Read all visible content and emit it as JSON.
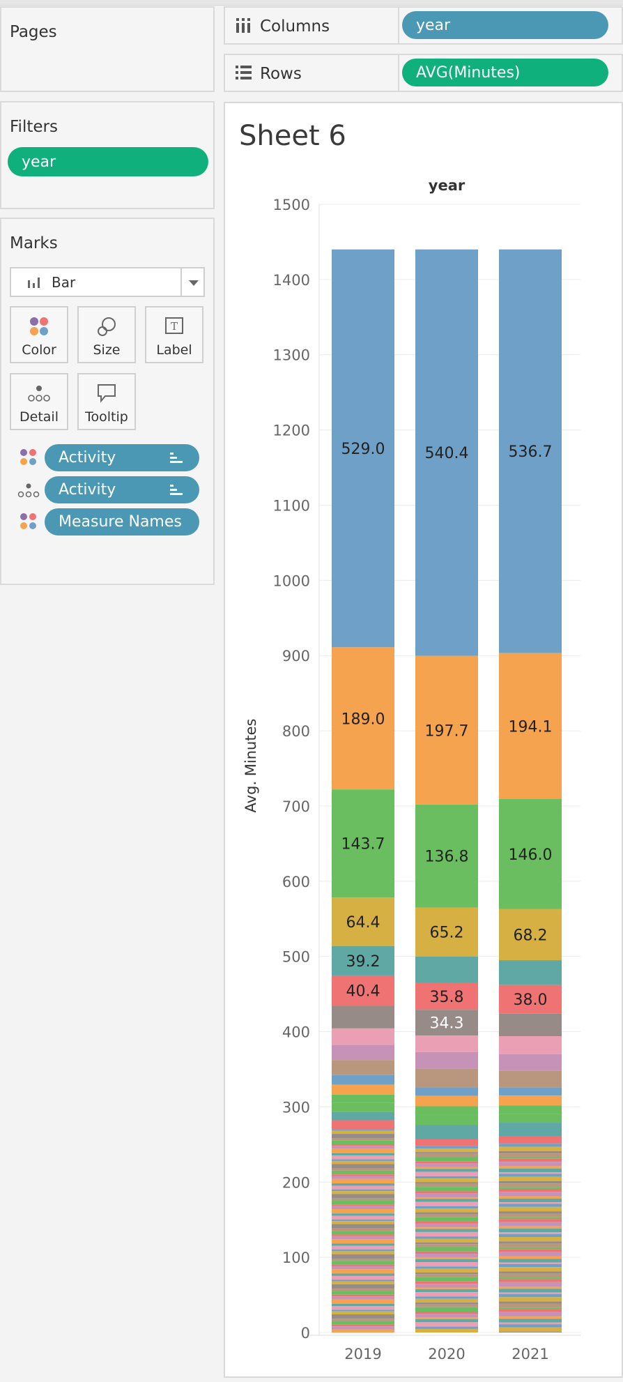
{
  "pages": {
    "title": "Pages"
  },
  "filters": {
    "title": "Filters",
    "pills": [
      "year"
    ]
  },
  "marks": {
    "title": "Marks",
    "mark_type": "Bar",
    "buttons": {
      "color": "Color",
      "size": "Size",
      "label": "Label",
      "detail": "Detail",
      "tooltip": "Tooltip"
    },
    "pills": [
      "Activity",
      "Activity",
      "Measure Names"
    ]
  },
  "shelves": {
    "columns_label": "Columns",
    "columns_pill": "year",
    "rows_label": "Rows",
    "rows_pill": "AVG(Minutes)"
  },
  "colors": {
    "accent_green": "#0fb07c",
    "accent_teal": "#4a98b3",
    "palette": [
      "#6fa1c8",
      "#f5a34f",
      "#6abe5f",
      "#d6b042",
      "#5fa8a4",
      "#ef7373",
      "#968b87",
      "#ea9fb4",
      "#c792b7",
      "#b9977e"
    ]
  },
  "sheet": {
    "title": "Sheet 6"
  },
  "chart_data": {
    "type": "bar",
    "stacked": true,
    "title": "year",
    "ylabel": "Avg. Minutes",
    "ylim": [
      0,
      1500
    ],
    "yticks": [
      0,
      100,
      200,
      300,
      400,
      500,
      600,
      700,
      800,
      900,
      1000,
      1100,
      1200,
      1300,
      1400,
      1500
    ],
    "categories": [
      "2019",
      "2020",
      "2021"
    ],
    "grid": true,
    "total": [
      1440,
      1440,
      1440
    ],
    "labeled_segments": [
      {
        "values": [
          529.0,
          540.4,
          536.7
        ],
        "labels": [
          "529.0",
          "540.4",
          "536.7"
        ],
        "color": "#6fa1c8",
        "label_color": "#222222"
      },
      {
        "values": [
          189.0,
          197.7,
          194.1
        ],
        "labels": [
          "189.0",
          "197.7",
          "194.1"
        ],
        "color": "#f5a34f",
        "label_color": "#222222"
      },
      {
        "values": [
          143.7,
          136.8,
          146.0
        ],
        "labels": [
          "143.7",
          "136.8",
          "146.0"
        ],
        "color": "#6abe5f",
        "label_color": "#222222"
      },
      {
        "values": [
          64.4,
          65.2,
          68.2
        ],
        "labels": [
          "64.4",
          "65.2",
          "68.2"
        ],
        "color": "#d6b042",
        "label_color": "#222222"
      },
      {
        "values": [
          39.2,
          35.0,
          33.0
        ],
        "labels": [
          "39.2",
          "",
          ""
        ],
        "color": "#5fa8a4",
        "label_color": "#222222"
      },
      {
        "values": [
          40.4,
          35.8,
          38.0
        ],
        "labels": [
          "40.4",
          "35.8",
          "38.0"
        ],
        "color": "#ef7373",
        "label_color": "#222222"
      },
      {
        "values": [
          30.0,
          34.3,
          30.0
        ],
        "labels": [
          "",
          "34.3",
          ""
        ],
        "color": "#968b87",
        "label_color": "#ffffff"
      }
    ],
    "unlabeled_segments": [
      {
        "values": [
          22,
          22,
          24
        ],
        "color": "#ea9fb4"
      },
      {
        "values": [
          20,
          22,
          22
        ],
        "color": "#c792b7"
      },
      {
        "values": [
          20,
          25,
          22
        ],
        "color": "#b9977e"
      },
      {
        "values": [
          13,
          11,
          11
        ],
        "color": "#6fa1c8"
      },
      {
        "values": [
          13,
          14,
          13
        ],
        "color": "#f5a34f"
      },
      {
        "values": [
          11,
          12,
          11
        ],
        "color": "#6abe5f"
      },
      {
        "values": [
          12,
          13,
          12
        ],
        "color": "#6abe5f"
      },
      {
        "values": [
          11,
          19,
          18
        ],
        "color": "#5fa8a4"
      },
      {
        "values": [
          12,
          9,
          10
        ],
        "color": "#ef7373"
      }
    ],
    "remaining_stack_colors": [
      "#6fa1c8",
      "#f5a34f",
      "#6abe5f",
      "#d6b042",
      "#5fa8a4",
      "#ef7373",
      "#968b87",
      "#ea9fb4",
      "#c792b7",
      "#b9977e"
    ]
  }
}
